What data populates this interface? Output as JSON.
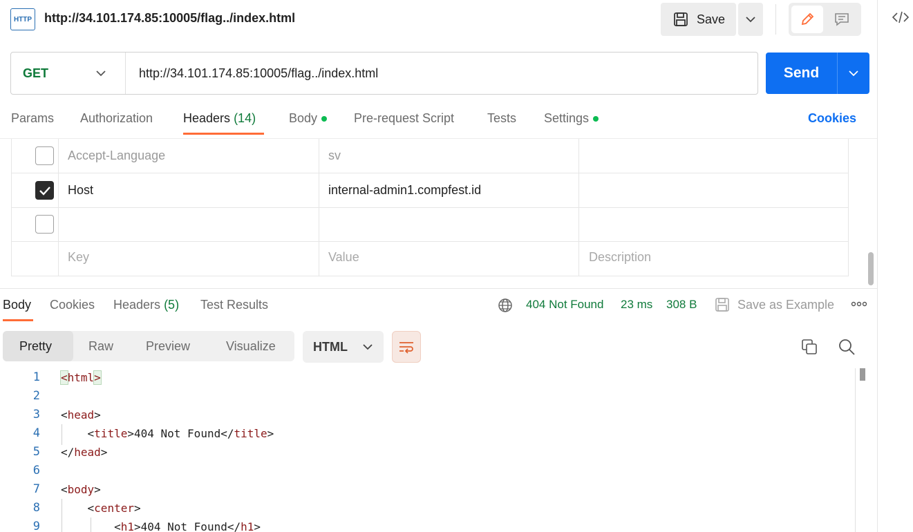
{
  "topbar": {
    "icon_text": "HTTP",
    "title": "http://34.101.174.85:10005/flag../index.html",
    "save_label": "Save"
  },
  "request": {
    "method": "GET",
    "url": "http://34.101.174.85:10005/flag../index.html",
    "send_label": "Send"
  },
  "request_tabs": {
    "params": "Params",
    "authorization": "Authorization",
    "headers": "Headers",
    "headers_count": "(14)",
    "body": "Body",
    "prerequest": "Pre-request Script",
    "tests": "Tests",
    "settings": "Settings",
    "cookies": "Cookies"
  },
  "headers_table": {
    "rows": [
      {
        "key": "Accept-Language",
        "value": "sv",
        "checked": false
      },
      {
        "key": "Host",
        "value": "internal-admin1.compfest.id",
        "checked": true
      },
      {
        "key": "",
        "value": "",
        "checked": false
      }
    ],
    "placeholder": {
      "key": "Key",
      "value": "Value",
      "description": "Description"
    }
  },
  "response_tabs": {
    "body": "Body",
    "cookies": "Cookies",
    "headers": "Headers",
    "headers_count": "(5)",
    "test_results": "Test Results"
  },
  "response_status": {
    "status": "404 Not Found",
    "time": "23 ms",
    "size": "308 B",
    "save_example": "Save as Example"
  },
  "body_toolbar": {
    "views": [
      "Pretty",
      "Raw",
      "Preview",
      "Visualize"
    ],
    "active_view": "Pretty",
    "format": "HTML"
  },
  "code_lines": [
    {
      "n": "1",
      "text": "<html>"
    },
    {
      "n": "2",
      "text": ""
    },
    {
      "n": "3",
      "text": "<head>"
    },
    {
      "n": "4",
      "text": "    <title>404 Not Found</title>"
    },
    {
      "n": "5",
      "text": "</head>"
    },
    {
      "n": "6",
      "text": ""
    },
    {
      "n": "7",
      "text": "<body>"
    },
    {
      "n": "8",
      "text": "    <center>"
    },
    {
      "n": "9",
      "text": "        <h1>404 Not Found</h1>"
    }
  ],
  "colors": {
    "accent": "#ff6c37",
    "primary": "#0e6ff2",
    "success": "#0f7a3a"
  }
}
